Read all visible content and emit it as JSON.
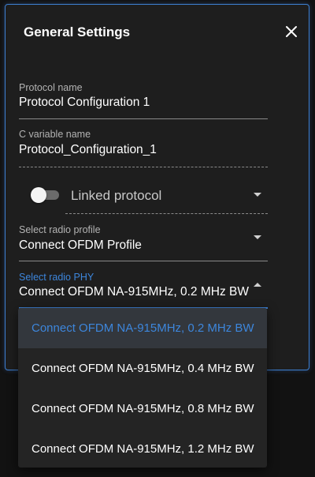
{
  "dialog": {
    "title": "General Settings",
    "close_icon": "close-icon"
  },
  "fields": {
    "protocol_name": {
      "label": "Protocol name",
      "value": "Protocol Configuration 1"
    },
    "c_variable_name": {
      "label": "C variable name",
      "value": "Protocol_Configuration_1"
    },
    "linked_protocol": {
      "label": "Linked protocol",
      "enabled": false
    },
    "radio_profile": {
      "label": "Select radio profile",
      "value": "Connect OFDM Profile"
    },
    "radio_phy": {
      "label": "Select radio PHY",
      "value": "Connect OFDM NA-915MHz, 0.2 MHz BW",
      "options": [
        "Connect OFDM NA-915MHz, 0.2 MHz BW",
        "Connect OFDM NA-915MHz, 0.4 MHz BW",
        "Connect OFDM NA-915MHz, 0.8 MHz BW",
        "Connect OFDM NA-915MHz, 1.2 MHz BW"
      ],
      "selected_index": 0
    }
  },
  "colors": {
    "accent": "#3d7fd0",
    "selected_text": "#3d86dc",
    "dialog_bg": "#1e1e1e",
    "menu_bg": "#242424"
  }
}
